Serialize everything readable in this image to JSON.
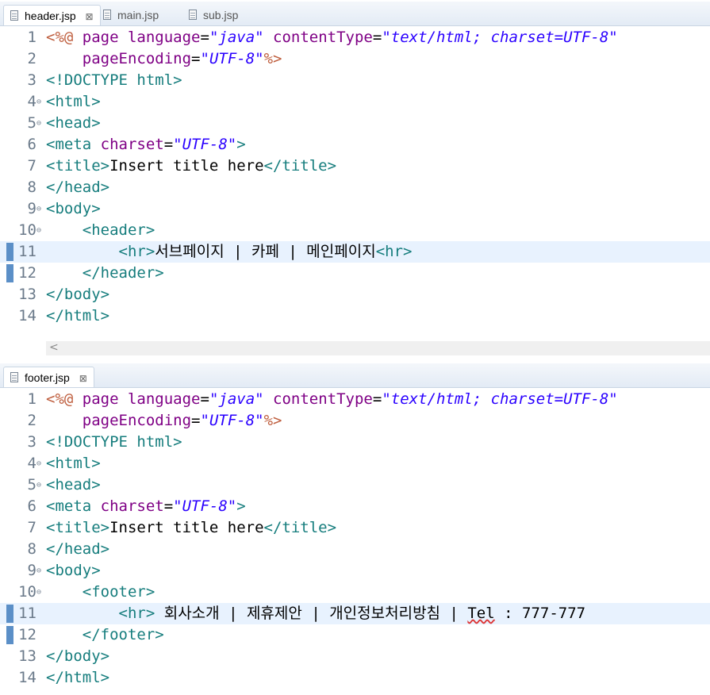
{
  "top_tabs": [
    {
      "label": "header.jsp",
      "active": true,
      "close": "⊠"
    },
    {
      "label": "main.jsp",
      "active": false
    },
    {
      "label": "sub.jsp",
      "active": false
    }
  ],
  "bottom_tabs": [
    {
      "label": "footer.jsp",
      "active": true,
      "close": "⊠"
    }
  ],
  "scroll_arrow": "<",
  "header_lines": [
    {
      "n": "1",
      "segs": [
        [
          "dir",
          "<%@ "
        ],
        [
          "attr",
          "page "
        ],
        [
          "attr",
          "language"
        ],
        [
          "txt",
          "="
        ],
        [
          "str",
          "\"java\""
        ],
        [
          "txt",
          " "
        ],
        [
          "attr",
          "contentType"
        ],
        [
          "txt",
          "="
        ],
        [
          "str",
          "\"text/html; charset=UTF-8\""
        ]
      ]
    },
    {
      "n": "2",
      "segs": [
        [
          "txt",
          "    "
        ],
        [
          "attr",
          "pageEncoding"
        ],
        [
          "txt",
          "="
        ],
        [
          "str",
          "\"UTF-8\""
        ],
        [
          "dir",
          "%>"
        ]
      ]
    },
    {
      "n": "3",
      "segs": [
        [
          "tag",
          "<!DOCTYPE "
        ],
        [
          "tag",
          "html"
        ],
        [
          "tag",
          ">"
        ]
      ]
    },
    {
      "n": "4",
      "fold": true,
      "segs": [
        [
          "tag",
          "<html>"
        ]
      ]
    },
    {
      "n": "5",
      "fold": true,
      "segs": [
        [
          "tag",
          "<head>"
        ]
      ]
    },
    {
      "n": "6",
      "segs": [
        [
          "tag",
          "<meta "
        ],
        [
          "attr",
          "charset"
        ],
        [
          "txt",
          "="
        ],
        [
          "str",
          "\"UTF-8\""
        ],
        [
          "tag",
          ">"
        ]
      ]
    },
    {
      "n": "7",
      "segs": [
        [
          "tag",
          "<title>"
        ],
        [
          "txt",
          "Insert title here"
        ],
        [
          "tag",
          "</title>"
        ]
      ]
    },
    {
      "n": "8",
      "segs": [
        [
          "tag",
          "</head>"
        ]
      ]
    },
    {
      "n": "9",
      "fold": true,
      "segs": [
        [
          "tag",
          "<body>"
        ]
      ]
    },
    {
      "n": "10",
      "fold": true,
      "segs": [
        [
          "txt",
          "    "
        ],
        [
          "tag",
          "<header>"
        ]
      ]
    },
    {
      "n": "11",
      "hl": true,
      "marker": true,
      "segs": [
        [
          "txt",
          "        "
        ],
        [
          "tag",
          "<hr>"
        ],
        [
          "txt",
          "서브페이지 | 카페 | 메인페이지"
        ],
        [
          "tag",
          "<hr>"
        ]
      ]
    },
    {
      "n": "12",
      "marker": true,
      "segs": [
        [
          "txt",
          "    "
        ],
        [
          "tag",
          "</header>"
        ]
      ]
    },
    {
      "n": "13",
      "segs": [
        [
          "tag",
          "</body>"
        ]
      ]
    },
    {
      "n": "14",
      "segs": [
        [
          "tag",
          "</html>"
        ]
      ]
    }
  ],
  "footer_lines": [
    {
      "n": "1",
      "segs": [
        [
          "dir",
          "<%@ "
        ],
        [
          "attr",
          "page "
        ],
        [
          "attr",
          "language"
        ],
        [
          "txt",
          "="
        ],
        [
          "str",
          "\"java\""
        ],
        [
          "txt",
          " "
        ],
        [
          "attr",
          "contentType"
        ],
        [
          "txt",
          "="
        ],
        [
          "str",
          "\"text/html; charset=UTF-8\""
        ]
      ]
    },
    {
      "n": "2",
      "segs": [
        [
          "txt",
          "    "
        ],
        [
          "attr",
          "pageEncoding"
        ],
        [
          "txt",
          "="
        ],
        [
          "str",
          "\"UTF-8\""
        ],
        [
          "dir",
          "%>"
        ]
      ]
    },
    {
      "n": "3",
      "segs": [
        [
          "tag",
          "<!DOCTYPE "
        ],
        [
          "tag",
          "html"
        ],
        [
          "tag",
          ">"
        ]
      ]
    },
    {
      "n": "4",
      "fold": true,
      "segs": [
        [
          "tag",
          "<html>"
        ]
      ]
    },
    {
      "n": "5",
      "fold": true,
      "segs": [
        [
          "tag",
          "<head>"
        ]
      ]
    },
    {
      "n": "6",
      "segs": [
        [
          "tag",
          "<meta "
        ],
        [
          "attr",
          "charset"
        ],
        [
          "txt",
          "="
        ],
        [
          "str",
          "\"UTF-8\""
        ],
        [
          "tag",
          ">"
        ]
      ]
    },
    {
      "n": "7",
      "segs": [
        [
          "tag",
          "<title>"
        ],
        [
          "txt",
          "Insert title here"
        ],
        [
          "tag",
          "</title>"
        ]
      ]
    },
    {
      "n": "8",
      "segs": [
        [
          "tag",
          "</head>"
        ]
      ]
    },
    {
      "n": "9",
      "fold": true,
      "segs": [
        [
          "tag",
          "<body>"
        ]
      ]
    },
    {
      "n": "10",
      "fold": true,
      "segs": [
        [
          "txt",
          "    "
        ],
        [
          "tag",
          "<footer>"
        ]
      ]
    },
    {
      "n": "11",
      "hl": true,
      "marker": true,
      "segs": [
        [
          "txt",
          "        "
        ],
        [
          "tag",
          "<hr>"
        ],
        [
          "txt",
          " 회사소개 | 제휴제안 | 개인정보처리방침 | "
        ],
        [
          "kw",
          "Tel"
        ],
        [
          "txt",
          " : 777-777"
        ]
      ]
    },
    {
      "n": "12",
      "marker": true,
      "segs": [
        [
          "txt",
          "    "
        ],
        [
          "tag",
          "</footer>"
        ]
      ]
    },
    {
      "n": "13",
      "segs": [
        [
          "tag",
          "</body>"
        ]
      ]
    },
    {
      "n": "14",
      "segs": [
        [
          "tag",
          "</html>"
        ]
      ]
    }
  ]
}
